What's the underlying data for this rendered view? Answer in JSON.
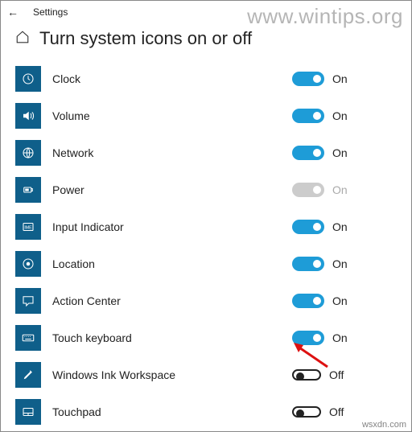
{
  "window": {
    "title": "Settings"
  },
  "page": {
    "title": "Turn system icons on or off"
  },
  "watermark": "www.wintips.org",
  "footer_watermark": "wsxdn.com",
  "labels": {
    "on": "On",
    "off": "Off"
  },
  "items": [
    {
      "id": "clock",
      "label": "Clock",
      "state": "on",
      "icon": "clock-icon"
    },
    {
      "id": "volume",
      "label": "Volume",
      "state": "on",
      "icon": "volume-icon"
    },
    {
      "id": "network",
      "label": "Network",
      "state": "on",
      "icon": "globe-icon"
    },
    {
      "id": "power",
      "label": "Power",
      "state": "disabled",
      "icon": "power-icon"
    },
    {
      "id": "input-indicator",
      "label": "Input Indicator",
      "state": "on",
      "icon": "ime-icon"
    },
    {
      "id": "location",
      "label": "Location",
      "state": "on",
      "icon": "location-icon"
    },
    {
      "id": "action-center",
      "label": "Action Center",
      "state": "on",
      "icon": "action-center-icon"
    },
    {
      "id": "touch-keyboard",
      "label": "Touch keyboard",
      "state": "on",
      "icon": "keyboard-icon"
    },
    {
      "id": "windows-ink",
      "label": "Windows Ink Workspace",
      "state": "off",
      "icon": "pen-icon"
    },
    {
      "id": "touchpad",
      "label": "Touchpad",
      "state": "off",
      "icon": "touchpad-icon"
    }
  ]
}
